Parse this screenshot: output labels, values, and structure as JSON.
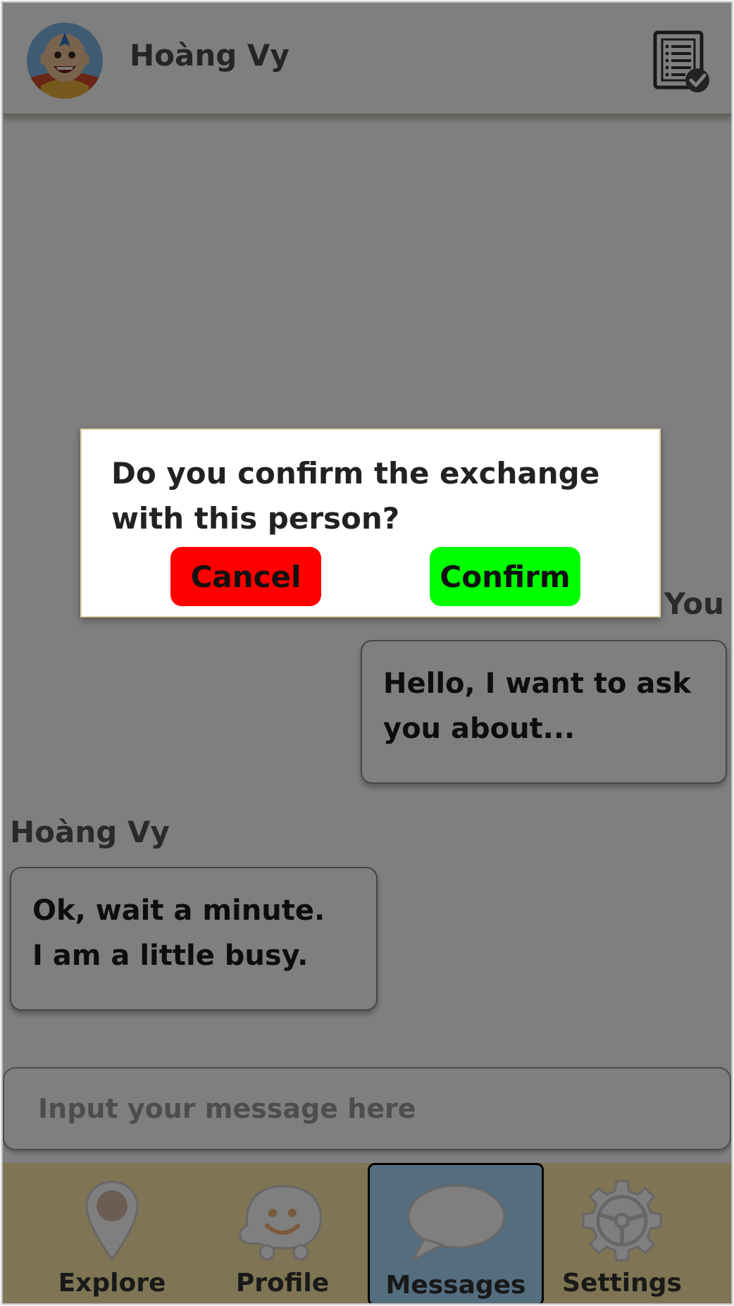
{
  "header": {
    "contact_name": "Hoàng Vy",
    "avatar_icon": "avatar-cartoon-icon",
    "action_icon": "checklist-check-icon"
  },
  "chat": {
    "messages": [
      {
        "sender": "You",
        "lines": [
          "Hello, I want to ask",
          "you about..."
        ]
      },
      {
        "sender": "Hoàng Vy",
        "lines": [
          "Ok, wait a minute.",
          "I am a little busy."
        ]
      }
    ]
  },
  "composer": {
    "placeholder": "Input your message here",
    "value": ""
  },
  "nav": {
    "items": [
      {
        "label": "Explore",
        "icon": "map-pin-icon"
      },
      {
        "label": "Profile",
        "icon": "smiley-face-icon"
      },
      {
        "label": "Messages",
        "icon": "speech-bubble-icon",
        "active": true
      },
      {
        "label": "Settings",
        "icon": "gear-icon"
      }
    ]
  },
  "dialog": {
    "message": "Do you confirm the exchange with this person?",
    "cancel_label": "Cancel",
    "confirm_label": "Confirm"
  },
  "colors": {
    "nav_bg": "#fee9a6",
    "nav_active": "#a8daff",
    "cancel": "#ff0000",
    "confirm": "#00ff00"
  }
}
